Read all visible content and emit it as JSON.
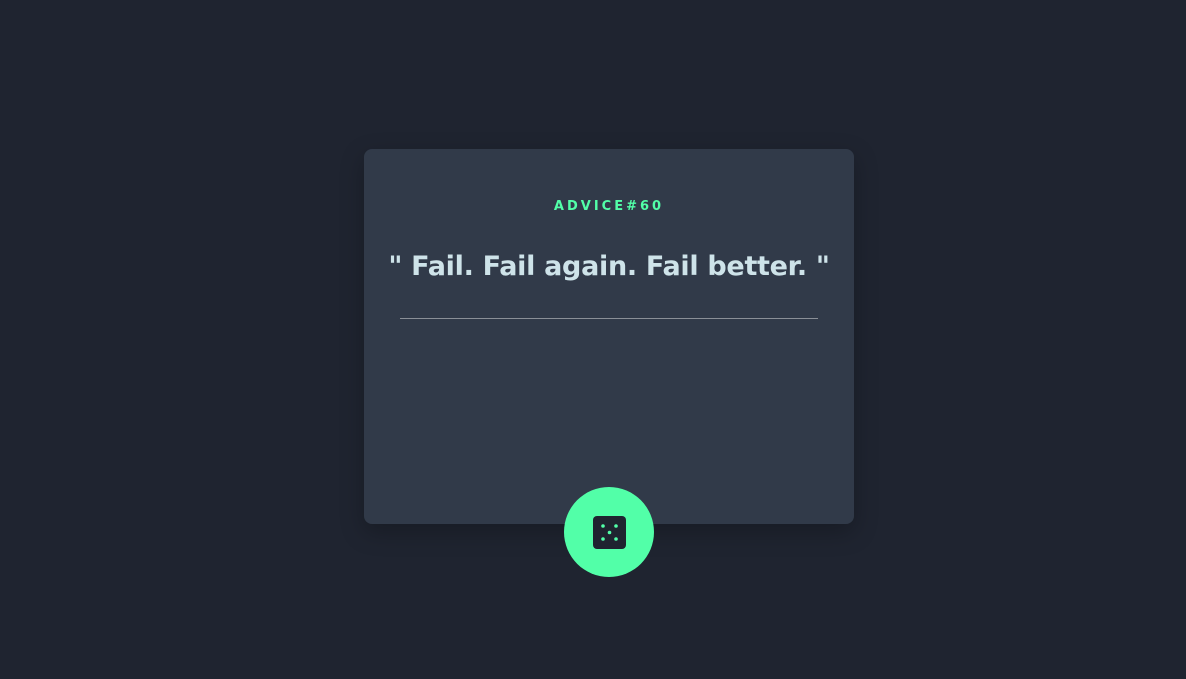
{
  "advice": {
    "id_label": "ADVICE#60",
    "quote": "\" Fail. Fail again. Fail better. \""
  },
  "dice_button": {
    "icon": "dice-icon"
  },
  "colors": {
    "background": "#1f2430",
    "card": "#313a49",
    "accent": "#52ffa8",
    "quote_text": "#cee3e9"
  }
}
